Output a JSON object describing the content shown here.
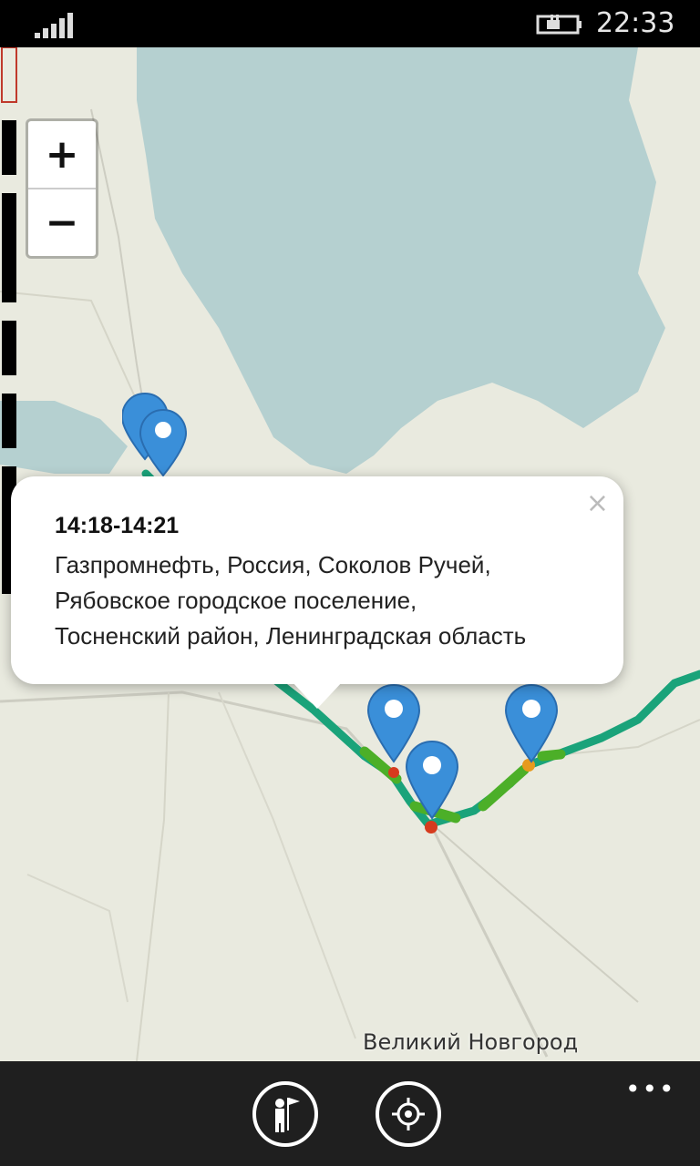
{
  "status_bar": {
    "time": "22:33",
    "signal_icon": "signal-strength-icon",
    "battery_icon": "battery-charging-icon"
  },
  "zoom_controls": {
    "zoom_in_label": "+",
    "zoom_out_label": "−"
  },
  "popup": {
    "time": "14:18-14:21",
    "address_line1": "Газпромнефть, Россия, Соколов Ручей,",
    "address_line2": "Рябовское городское поселение,",
    "address_line3": "Тосненский район, Ленинградская область",
    "close_label": "×"
  },
  "map": {
    "city_label": "Великий Новгород",
    "track_color": "#1aa37a",
    "marker_color": "#3a8fd9",
    "water_color": "#b5d0d0",
    "land_color": "#e9eadf"
  },
  "app_bar": {
    "buttons": [
      {
        "icon": "traveler-flag-icon"
      },
      {
        "icon": "locate-me-icon"
      }
    ],
    "more_label": "•••"
  }
}
